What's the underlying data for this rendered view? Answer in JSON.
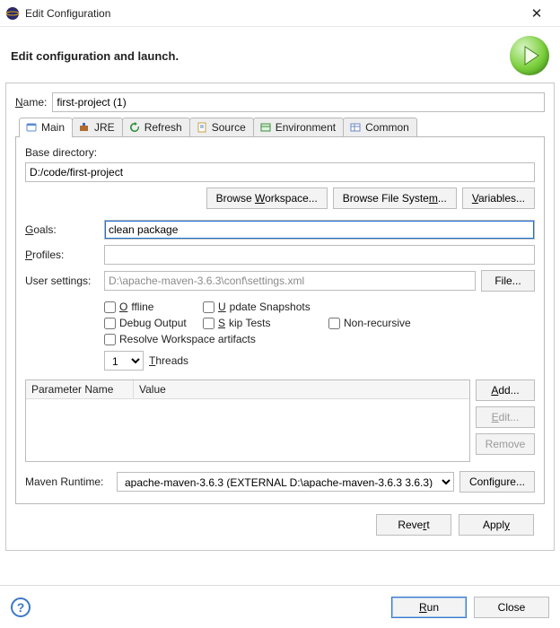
{
  "window": {
    "title": "Edit Configuration",
    "close": "✕"
  },
  "header": {
    "heading": "Edit configuration and launch."
  },
  "name": {
    "label": "Name:",
    "value": "first-project (1)"
  },
  "tabs": {
    "main": {
      "label": "Main"
    },
    "jre": {
      "label": "JRE"
    },
    "refresh": {
      "label": "Refresh"
    },
    "source": {
      "label": "Source"
    },
    "environment": {
      "label": "Environment"
    },
    "common": {
      "label": "Common"
    }
  },
  "main": {
    "base_directory_label": "Base directory:",
    "base_directory_value": "D:/code/first-project",
    "browse_workspace": "Browse Workspace...",
    "browse_filesystem": "Browse File System...",
    "variables": "Variables...",
    "goals_label": "Goals:",
    "goals_value": "clean package",
    "profiles_label": "Profiles:",
    "profiles_value": "",
    "user_settings_label": "User settings:",
    "user_settings_value": "D:\\apache-maven-3.6.3\\conf\\settings.xml",
    "file_button": "File...",
    "checks": {
      "offline": "Offline",
      "update_snapshots": "Update Snapshots",
      "debug_output": "Debug Output",
      "skip_tests": "Skip Tests",
      "non_recursive": "Non-recursive",
      "resolve_workspace": "Resolve Workspace artifacts"
    },
    "threads_value": "1",
    "threads_label": "Threads",
    "params": {
      "col_name": "Parameter Name",
      "col_value": "Value",
      "add": "Add...",
      "edit": "Edit...",
      "remove": "Remove"
    },
    "runtime_label": "Maven Runtime:",
    "runtime_value": "apache-maven-3.6.3 (EXTERNAL D:\\apache-maven-3.6.3 3.6.3)",
    "configure": "Configure..."
  },
  "buttons": {
    "revert": "Revert",
    "apply": "Apply",
    "run": "Run",
    "close": "Close"
  }
}
